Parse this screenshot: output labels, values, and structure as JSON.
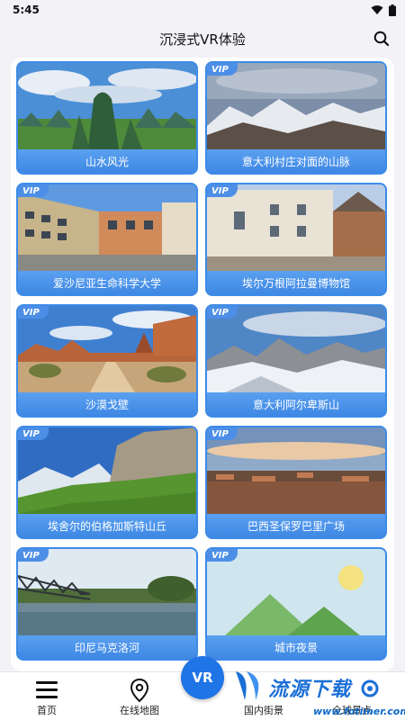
{
  "status_bar": {
    "time": "5:45"
  },
  "header": {
    "title": "沉浸式VR体验"
  },
  "vip_text": "VIP",
  "cards": [
    {
      "label": "山水风光",
      "vip": false
    },
    {
      "label": "意大利村庄对面的山脉",
      "vip": true
    },
    {
      "label": "爱沙尼亚生命科学大学",
      "vip": true
    },
    {
      "label": "埃尔万根阿拉曼博物馆",
      "vip": true
    },
    {
      "label": "沙漠戈壁",
      "vip": true
    },
    {
      "label": "意大利阿尔卑斯山",
      "vip": true
    },
    {
      "label": "埃舍尔的伯格加斯特山丘",
      "vip": true
    },
    {
      "label": "巴西圣保罗巴里广场",
      "vip": true
    },
    {
      "label": "印尼马克洛河",
      "vip": true
    },
    {
      "label": "城市夜景",
      "vip": true
    }
  ],
  "bottom_nav": {
    "home": "首页",
    "map": "在线地图",
    "vr": "VR",
    "domestic": "国内街景",
    "global": "全球景点"
  },
  "watermark": {
    "url": "www.fotimer.com",
    "logo": "流源下载"
  }
}
